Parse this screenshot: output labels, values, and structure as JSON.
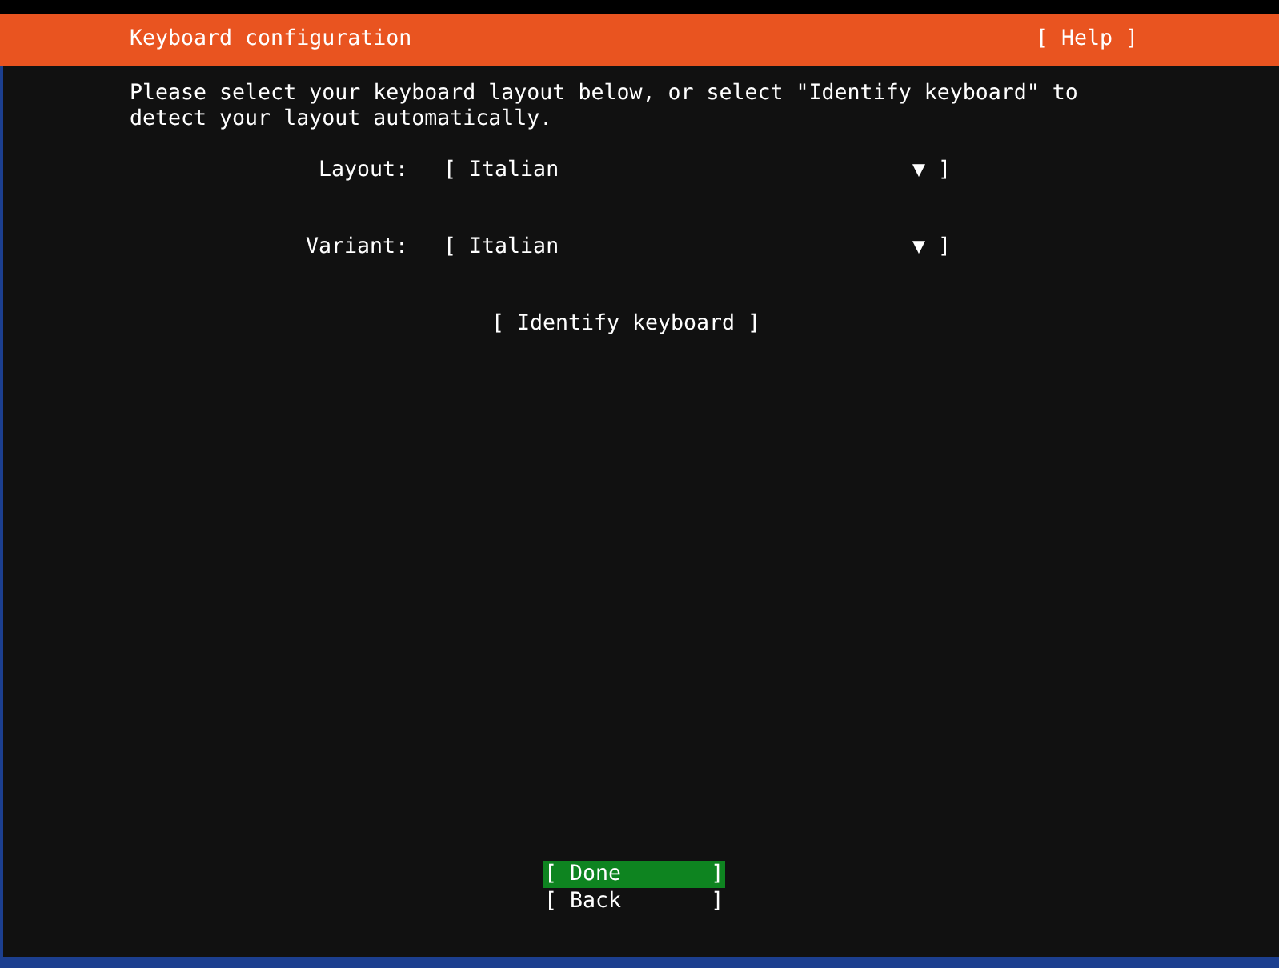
{
  "header": {
    "title": "Keyboard configuration",
    "help": "[ Help ]"
  },
  "instructions": "Please select your keyboard layout below, or select \"Identify keyboard\" to detect your layout automatically.",
  "fields": [
    {
      "label": "Layout:",
      "open": "[",
      "value": "Italian",
      "arrow": "▼",
      "close": "]"
    },
    {
      "label": "Variant:",
      "open": "[",
      "value": "Italian",
      "arrow": "▼",
      "close": "]"
    }
  ],
  "identify_button": "[ Identify keyboard ]",
  "buttons": [
    {
      "label": "[ Done       ]",
      "selected": true
    },
    {
      "label": "[ Back       ]",
      "selected": false
    }
  ]
}
